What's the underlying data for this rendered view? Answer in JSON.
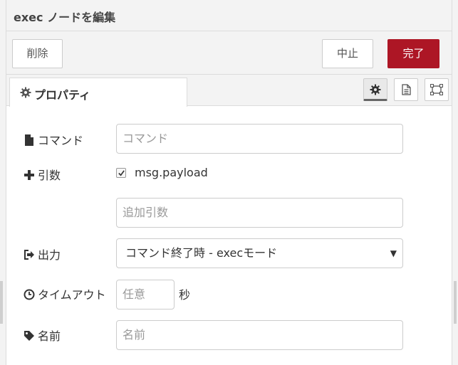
{
  "header": {
    "title": "exec ノードを編集"
  },
  "buttons": {
    "delete": "削除",
    "cancel": "中止",
    "done": "完了"
  },
  "tabs": {
    "properties": "プロパティ"
  },
  "form": {
    "command": {
      "label": "コマンド",
      "placeholder": "コマンド"
    },
    "append": {
      "label": "引数",
      "checkbox_label": "msg.payload",
      "checked": true,
      "extra_placeholder": "追加引数"
    },
    "output": {
      "label": "出力",
      "selected": "コマンド終了時 - execモード"
    },
    "timeout": {
      "label": "タイムアウト",
      "placeholder": "任意",
      "unit": "秒"
    },
    "name": {
      "label": "名前",
      "placeholder": "名前"
    }
  },
  "icons": {
    "tab": "gear-icon",
    "settings": "gear-icon",
    "description": "file-text-icon",
    "appearance": "window-maximize-icon",
    "command": "file-icon",
    "append": "plus-icon",
    "output": "sign-out-icon",
    "timeout": "clock-icon",
    "name": "tag-icon"
  },
  "colors": {
    "primary": "#ad1625",
    "border": "#cccccc",
    "panel": "#f3f3f3"
  }
}
